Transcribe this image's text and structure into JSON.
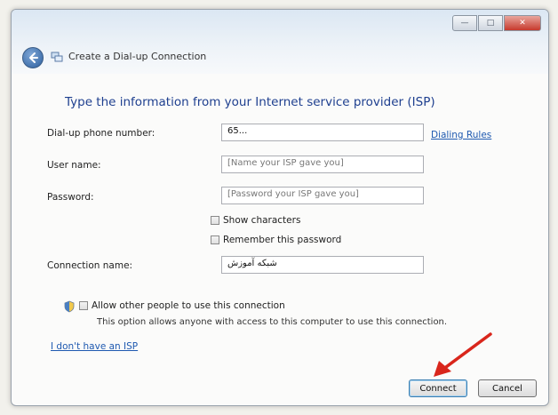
{
  "window": {
    "title": "Create a Dial-up Connection",
    "controls": {
      "minimize": "—",
      "maximize": "□",
      "close": "✕"
    }
  },
  "heading": "Type the information from your Internet service provider (ISP)",
  "fields": {
    "phone": {
      "label": "Dial-up phone number:",
      "value": "65..."
    },
    "username": {
      "label": "User name:",
      "placeholder": "[Name your ISP gave you]"
    },
    "password": {
      "label": "Password:",
      "placeholder": "[Password your ISP gave you]"
    },
    "connection_name": {
      "label": "Connection name:",
      "value": "شبکه آموزش"
    }
  },
  "links": {
    "dialing_rules": "Dialing Rules",
    "no_isp": "I don't have an ISP"
  },
  "checkboxes": {
    "show_characters": "Show characters",
    "remember_password": "Remember this password",
    "allow_others": "Allow other people to use this connection"
  },
  "note": "This option allows anyone with access to this computer to use this connection.",
  "buttons": {
    "connect": "Connect",
    "cancel": "Cancel"
  },
  "colors": {
    "heading": "#1e3f8f",
    "link": "#1e59b0",
    "arrow": "#d9261c"
  }
}
